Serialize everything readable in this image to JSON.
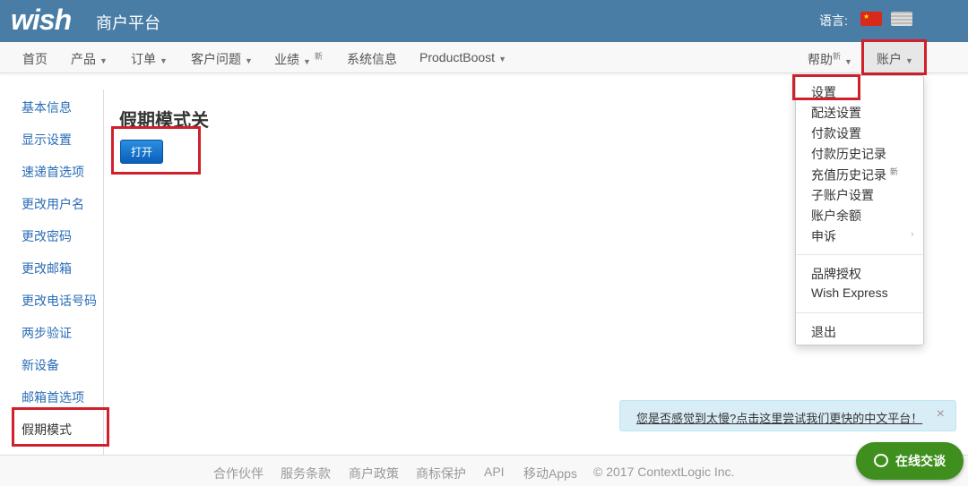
{
  "header": {
    "logo": "wish",
    "subtitle": "商户平台",
    "language_label": "语言:"
  },
  "nav": {
    "items": [
      "首页",
      "产品",
      "订单",
      "客户问题",
      "业绩",
      "系统信息",
      "ProductBoost"
    ],
    "new_badge": "新",
    "help": "帮助",
    "account": "账户"
  },
  "sidebar": {
    "items": [
      "基本信息",
      "显示设置",
      "速递首选项",
      "更改用户名",
      "更改密码",
      "更改邮箱",
      "更改电话号码",
      "两步验证",
      "新设备",
      "邮箱首选项",
      "假期模式"
    ]
  },
  "main": {
    "title": "假期模式关",
    "button": "打开"
  },
  "dropdown": {
    "items": [
      "设置",
      "配送设置",
      "付款设置",
      "付款历史记录",
      "充值历史记录",
      "子账户设置",
      "账户余额",
      "申诉"
    ],
    "items2": [
      "品牌授权",
      "Wish Express"
    ],
    "logout": "退出",
    "new_badge": "新"
  },
  "alert": {
    "text": "您是否感觉到太慢?点击这里尝试我们更快的中文平台！",
    "close": "×"
  },
  "footer": {
    "items": [
      "合作伙伴",
      "服务条款",
      "商户政策",
      "商标保护",
      "API",
      "移动Apps",
      "© 2017 ContextLogic Inc."
    ]
  },
  "chat": {
    "label": "在线交谈"
  }
}
